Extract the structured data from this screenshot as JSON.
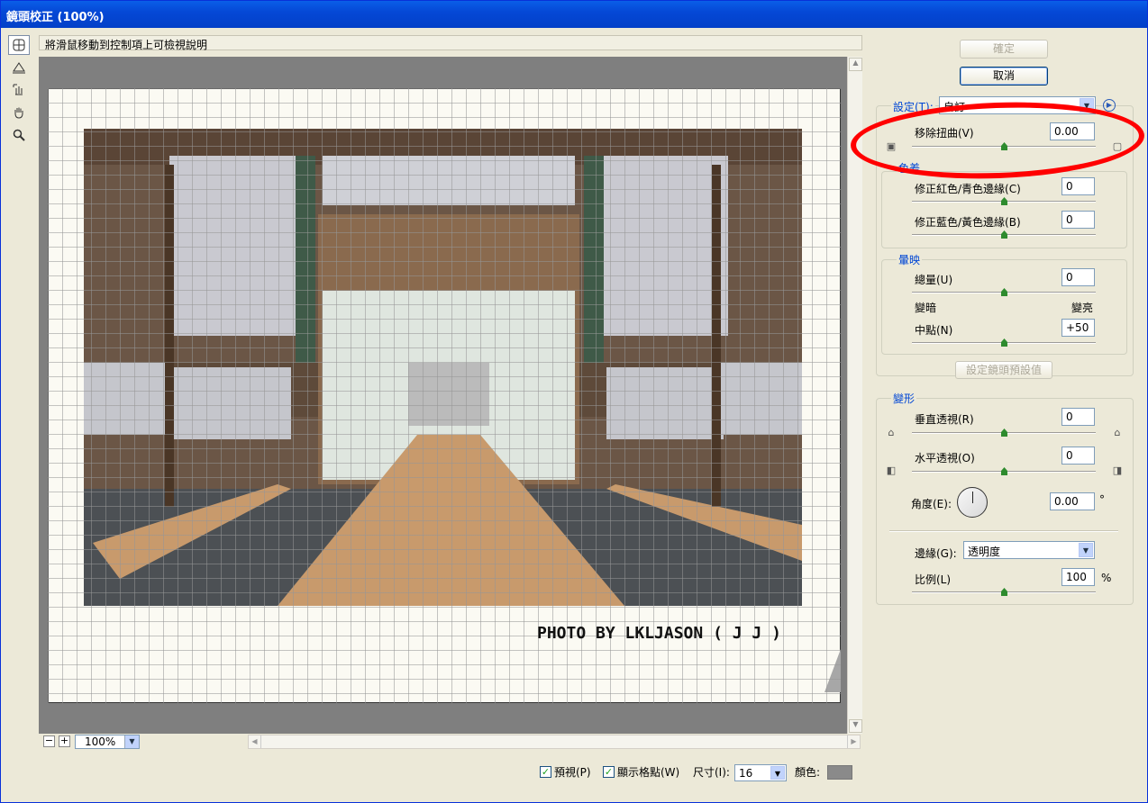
{
  "window": {
    "title": "鏡頭校正 (100%)"
  },
  "hint": "將滑鼠移動到控制項上可檢視說明",
  "tools": [
    "remove-distortion-tool",
    "straighten-tool",
    "move-grid-tool",
    "hand-tool",
    "zoom-tool"
  ],
  "canvas": {
    "credit": "PHOTO BY LKLJASON ( J J )"
  },
  "zoom": {
    "minus": "−",
    "plus": "+",
    "value": "100%"
  },
  "footer": {
    "preview_label": "預視(P)",
    "preview_checked": true,
    "grid_label": "顯示格點(W)",
    "grid_checked": true,
    "size_label": "尺寸(I):",
    "size_value": "16",
    "color_label": "顏色:",
    "grid_color": "#8a8a8a"
  },
  "buttons": {
    "ok": "確定",
    "cancel": "取消",
    "set_lens_default": "設定鏡頭預設值"
  },
  "settings": {
    "label": "設定(T):",
    "value": "自訂"
  },
  "distortion": {
    "label": "移除扭曲(V)",
    "value": "0.00"
  },
  "chromatic": {
    "title": "色差",
    "red_cyan_label": "修正紅色/青色邊緣(C)",
    "red_cyan_value": "0",
    "blue_yellow_label": "修正藍色/黃色邊緣(B)",
    "blue_yellow_value": "0"
  },
  "vignette": {
    "title": "暈映",
    "amount_label": "總量(U)",
    "amount_value": "0",
    "darken_label": "變暗",
    "lighten_label": "變亮",
    "midpoint_label": "中點(N)",
    "midpoint_value": "+50"
  },
  "transform": {
    "title": "變形",
    "vertical_label": "垂直透視(R)",
    "vertical_value": "0",
    "horizontal_label": "水平透視(O)",
    "horizontal_value": "0",
    "angle_label": "角度(E):",
    "angle_value": "0.00",
    "angle_unit": "°",
    "edge_label": "邊緣(G):",
    "edge_value": "透明度",
    "scale_label": "比例(L)",
    "scale_value": "100",
    "scale_unit": "%"
  },
  "colors": {
    "accent": "#0046d5",
    "highlight_ring": "#ff0000",
    "title_bar": "#0548d6"
  }
}
